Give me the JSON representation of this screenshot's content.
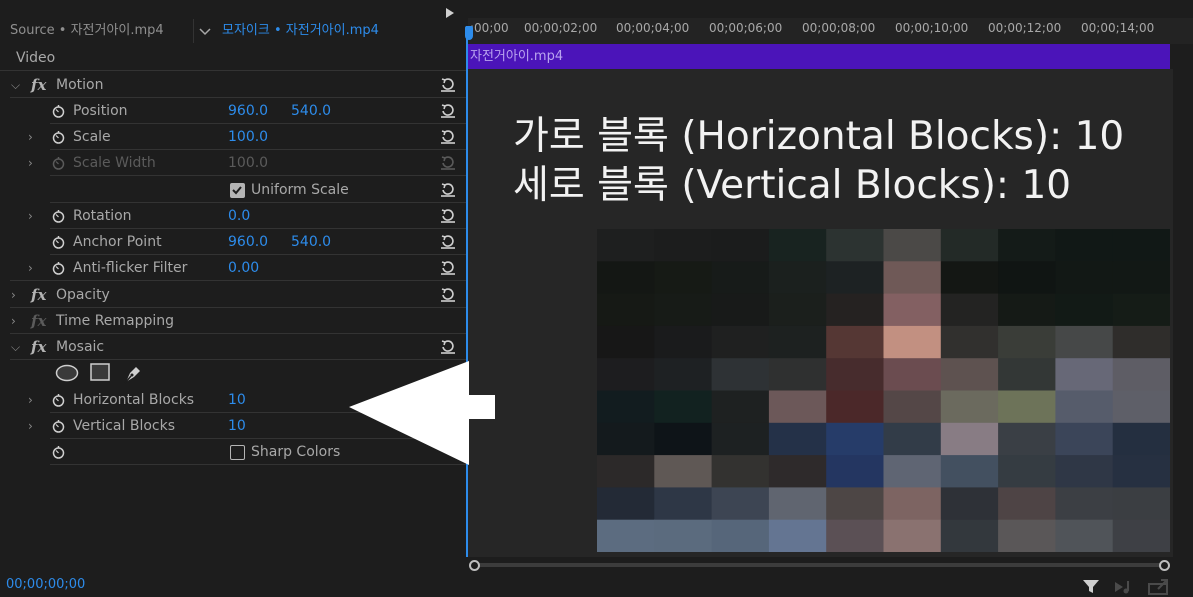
{
  "header": {
    "source_tab": "Source • 자전거아이.mp4",
    "active_clip": "모자이크 • 자전거아이.mp4"
  },
  "section_label": "Video",
  "effects": {
    "motion": {
      "name": "Motion",
      "position": {
        "label": "Position",
        "x": "960.0",
        "y": "540.0"
      },
      "scale": {
        "label": "Scale",
        "value": "100.0"
      },
      "scale_width": {
        "label": "Scale Width",
        "value": "100.0"
      },
      "uniform_scale": {
        "label": "Uniform Scale",
        "checked": true
      },
      "rotation": {
        "label": "Rotation",
        "value": "0.0"
      },
      "anchor_point": {
        "label": "Anchor Point",
        "x": "960.0",
        "y": "540.0"
      },
      "anti_flicker": {
        "label": "Anti-flicker Filter",
        "value": "0.00"
      }
    },
    "opacity": {
      "name": "Opacity"
    },
    "time_remapping": {
      "name": "Time Remapping"
    },
    "mosaic": {
      "name": "Mosaic",
      "horizontal_blocks": {
        "label": "Horizontal Blocks",
        "value": "10"
      },
      "vertical_blocks": {
        "label": "Vertical Blocks",
        "value": "10"
      },
      "sharp_colors": {
        "label": "Sharp Colors",
        "checked": false
      }
    }
  },
  "timeline": {
    "ticks": [
      ":00;00",
      "00;00;02;00",
      "00;00;04;00",
      "00;00;06;00",
      "00;00;08;00",
      "00;00;10;00",
      "00;00;12;00",
      "00;00;14;00"
    ],
    "clip_name": "자전거아이.mp4"
  },
  "annotation": {
    "line1": "가로 블록 (Horizontal Blocks): 10",
    "line2": "세로 블록 (Vertical Blocks): 10"
  },
  "mosaic_grid": [
    [
      "#1e1f1f",
      "#1c1d1d",
      "#1b1c1c",
      "#182320",
      "#2c3331",
      "#4b4947",
      "#232a27",
      "#141b18",
      "#111816",
      "#111816"
    ],
    [
      "#141714",
      "#161a15",
      "#171b19",
      "#1b201e",
      "#1d2223",
      "#6f5957",
      "#141714",
      "#101513",
      "#121815",
      "#121815"
    ],
    [
      "#161915",
      "#171b17",
      "#181a19",
      "#1b1f1c",
      "#252221",
      "#836062",
      "#232322",
      "#151a16",
      "#121a16",
      "#151c17"
    ],
    [
      "#171717",
      "#1a1b1c",
      "#1f2020",
      "#1d2120",
      "#553734",
      "#c29081",
      "#31302e",
      "#3a3d38",
      "#464848",
      "#2f2d2b"
    ],
    [
      "#1d1d1f",
      "#1e2123",
      "#2e3235",
      "#2f3030",
      "#472c2d",
      "#6b4c50",
      "#5e5250",
      "#333736",
      "#676877",
      "#5e5d65"
    ],
    [
      "#121c1f",
      "#122220",
      "#1e2121",
      "#6c5859",
      "#4b2829",
      "#544747",
      "#6b6a5e",
      "#6d7359",
      "#565c6b",
      "#5e5f68"
    ],
    [
      "#141a1d",
      "#0e1418",
      "#1d2122",
      "#243148",
      "#263c69",
      "#323c48",
      "#887c84",
      "#3a3f45",
      "#3b4559",
      "#242f40"
    ],
    [
      "#2c2929",
      "#5f5855",
      "#333230",
      "#2e2a2b",
      "#243661",
      "#5f6573",
      "#435060",
      "#353c42",
      "#2f3746",
      "#263041"
    ],
    [
      "#232a36",
      "#2e3746",
      "#3d4553",
      "#606570",
      "#4d4645",
      "#7d6462",
      "#2e3137",
      "#4e4445",
      "#3c3f44",
      "#3b3e42"
    ],
    [
      "#5c6c80",
      "#5b6b7e",
      "#56667a",
      "#647592",
      "#5b5055",
      "#8a7270",
      "#33383d",
      "#5a5758",
      "#505459",
      "#3e4045"
    ]
  ],
  "status": {
    "timecode": "00;00;00;00"
  },
  "icons": {
    "stopwatch": "stopwatch-icon",
    "reset": "reset-icon",
    "ellipse_mask": "ellipse-mask-icon",
    "rect_mask": "rectangle-mask-icon",
    "pen_mask": "pen-mask-icon",
    "filter": "filter-icon",
    "export": "export-icon"
  }
}
